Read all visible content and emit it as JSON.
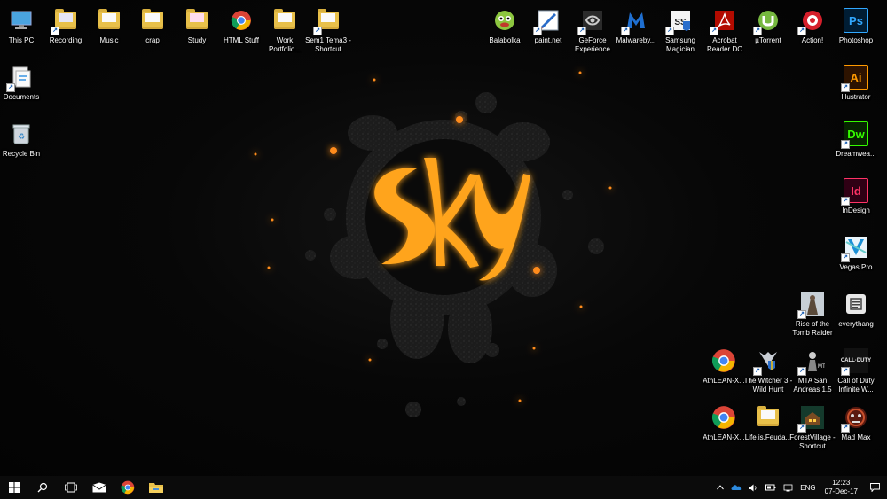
{
  "wallpaper": {
    "logo_text": "Sky",
    "accent": "#ff9a1a"
  },
  "icons_left": [
    {
      "label": "This PC",
      "icon": "monitor-icon"
    },
    {
      "label": "Recording",
      "icon": "folder-icon"
    },
    {
      "label": "Music",
      "icon": "folder-icon"
    },
    {
      "label": "crap",
      "icon": "folder-icon"
    },
    {
      "label": "Study",
      "icon": "folder-icon"
    },
    {
      "label": "HTML Stuff",
      "icon": "chrome-icon"
    },
    {
      "label": "Work Portfolio...",
      "icon": "folder-icon"
    },
    {
      "label": "Sem1 Tema3 - Shortcut",
      "icon": "folder-icon"
    },
    {
      "label": "Documents",
      "icon": "documents-icon"
    },
    {
      "label": "Recycle Bin",
      "icon": "recycle-bin-icon"
    }
  ],
  "icons_right_top": [
    {
      "label": "Balabolka",
      "icon": "balabolka-icon"
    },
    {
      "label": "paint.net",
      "icon": "paintnet-icon"
    },
    {
      "label": "GeForce Experience",
      "icon": "geforce-icon"
    },
    {
      "label": "Malwareby...",
      "icon": "malwarebytes-icon"
    },
    {
      "label": "Samsung Magician",
      "icon": "samsung-magician-icon"
    },
    {
      "label": "Acrobat Reader DC",
      "icon": "acrobat-icon"
    },
    {
      "label": "µTorrent",
      "icon": "utorrent-icon"
    },
    {
      "label": "Action!",
      "icon": "action-icon"
    },
    {
      "label": "Photoshop",
      "icon": "photoshop-icon",
      "abbr": "Ps"
    }
  ],
  "icons_right_col": [
    {
      "label": "Illustrator",
      "icon": "illustrator-icon",
      "abbr": "Ai"
    },
    {
      "label": "Dreamwea...",
      "icon": "dreamweaver-icon",
      "abbr": "Dw"
    },
    {
      "label": "InDesign",
      "icon": "indesign-icon",
      "abbr": "Id"
    },
    {
      "label": "Vegas Pro",
      "icon": "vegas-pro-icon"
    },
    {
      "label": "everythang",
      "icon": "text-file-icon"
    },
    {
      "label": "Call of Duty Infinite W...",
      "icon": "call-of-duty-icon",
      "abbr": "CALL·DUTY"
    },
    {
      "label": "Mad Max",
      "icon": "mad-max-icon"
    }
  ],
  "icons_games": [
    {
      "label": "Rise of the Tomb Raider",
      "icon": "tomb-raider-icon"
    },
    {
      "label": "AthLEAN-X...",
      "icon": "chrome-icon"
    },
    {
      "label": "The Witcher 3 - Wild Hunt",
      "icon": "witcher-icon"
    },
    {
      "label": "MTA San Andreas 1.5",
      "icon": "mta-icon"
    },
    {
      "label": "AthLEAN-X...",
      "icon": "chrome-icon"
    },
    {
      "label": "Life.is.Feuda...",
      "icon": "folder-icon"
    },
    {
      "label": "ForestVillage - Shortcut",
      "icon": "forest-village-icon"
    }
  ],
  "taskbar": {
    "items": [
      {
        "name": "start-button",
        "icon": "windows-icon"
      },
      {
        "name": "search-button",
        "icon": "search-icon"
      },
      {
        "name": "task-view-button",
        "icon": "task-view-icon"
      },
      {
        "name": "mail-button",
        "icon": "mail-icon"
      },
      {
        "name": "chrome-button",
        "icon": "chrome-icon"
      },
      {
        "name": "file-explorer-button",
        "icon": "folder-icon"
      }
    ],
    "tray": {
      "language": "ENG",
      "time": "12:23",
      "date": "07-Dec-17"
    }
  }
}
